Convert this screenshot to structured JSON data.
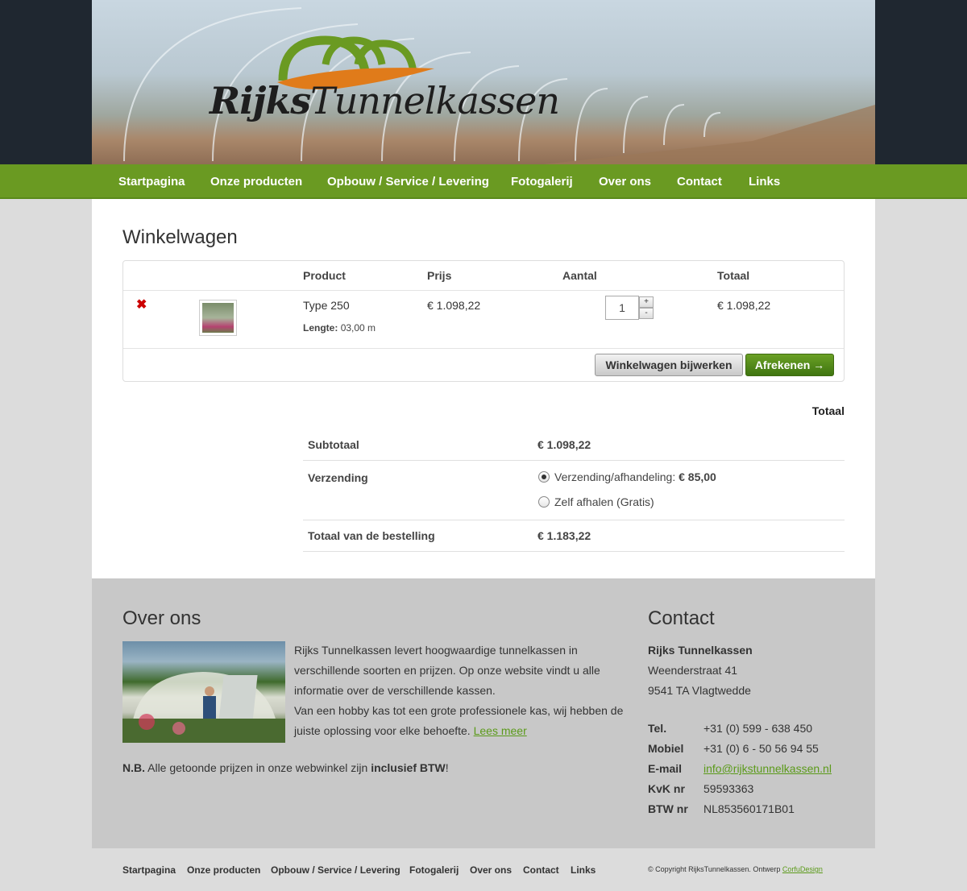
{
  "brand": {
    "name_part1": "Rijks",
    "name_part2": "Tunnelkassen"
  },
  "nav": {
    "items": [
      "Startpagina",
      "Onze producten",
      "Opbouw / Service / Levering",
      "Fotogalerij",
      "Over ons",
      "Contact",
      "Links"
    ]
  },
  "cart": {
    "title": "Winkelwagen",
    "columns": {
      "product": "Product",
      "price": "Prijs",
      "quantity": "Aantal",
      "total": "Totaal"
    },
    "item": {
      "remove_symbol": "✖",
      "name": "Type 250",
      "meta_label": "Lengte:",
      "meta_value": "03,00 m",
      "price": "€ 1.098,22",
      "quantity": "1",
      "total": "€ 1.098,22"
    },
    "update_button": "Winkelwagen bijwerken",
    "checkout_button": "Afrekenen →"
  },
  "totals": {
    "heading": "Totaal",
    "subtotal_label": "Subtotaal",
    "subtotal_value": "€ 1.098,22",
    "shipping_label": "Verzending",
    "shipping_option1_label": "Verzending/afhandeling:",
    "shipping_option1_price": "€ 85,00",
    "shipping_option2_label": "Zelf afhalen (Gratis)",
    "order_total_label": "Totaal van de bestelling",
    "order_total_value": "€ 1.183,22"
  },
  "footer": {
    "about_title": "Over ons",
    "about_text": "Rijks Tunnelkassen levert hoogwaardige tunnelkassen in verschillende soorten en prijzen. Op onze website vindt u alle informatie over de verschillende kassen.",
    "about_text2": "Van een hobby kas tot een grote professionele kas, wij hebben de juiste oplossing voor elke behoefte.",
    "read_more": "Lees meer",
    "note_prefix": "N.B.",
    "note_text": "Alle getoonde prijzen in onze webwinkel zijn",
    "note_bold": "inclusief BTW",
    "note_suffix": "!",
    "contact_title": "Contact",
    "company": "Rijks Tunnelkassen",
    "street": "Weenderstraat 41",
    "city": "9541 TA Vlagtwedde",
    "tel_label": "Tel.",
    "tel": "+31 (0) 599 - 638 450",
    "mobile_label": "Mobiel",
    "mobile": "+31 (0) 6 - 50 56 94 55",
    "email_label": "E-mail",
    "email": "info@rijkstunnelkassen.nl",
    "kvk_label": "KvK nr",
    "kvk": "59593363",
    "btw_label": "BTW nr",
    "btw": "NL853560171B01"
  },
  "bottom_nav": [
    "Startpagina",
    "Onze producten",
    "Opbouw / Service / Levering",
    "Fotogalerij",
    "Over ons",
    "Contact",
    "Links"
  ],
  "copyright": {
    "text": "© Copyright RijksTunnelkassen. Ontwerp",
    "designer": "CorfuDesign"
  },
  "colors": {
    "nav_green": "#6a9a22",
    "link_green": "#5b9a1a",
    "remove_red": "#cc0000",
    "header_dark": "#1f2730"
  }
}
